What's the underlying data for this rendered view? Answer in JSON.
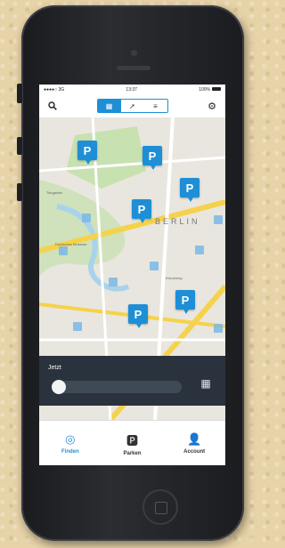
{
  "status_bar": {
    "carrier": "●●●●○ 3G",
    "time": "13:37",
    "battery": "100%"
  },
  "toolbar": {
    "search_icon": "search-icon",
    "segments": [
      {
        "icon": "map-icon",
        "glyph": "▦"
      },
      {
        "icon": "locate-icon",
        "glyph": "➚"
      },
      {
        "icon": "list-icon",
        "glyph": "≡"
      }
    ],
    "settings_icon": "gear-icon"
  },
  "map": {
    "city_label": "BERLIN",
    "street_labels": [
      "Tiergarten",
      "Deutsches Museum",
      "Kreuzberg"
    ],
    "accent": "#1e8fd6"
  },
  "panel": {
    "label": "Jetzt"
  },
  "tabs": [
    {
      "label": "Finden",
      "icon": "target-icon",
      "glyph": "◎",
      "active": true
    },
    {
      "label": "Parken",
      "icon": "parking-icon",
      "glyph": "🅿",
      "active": false
    },
    {
      "label": "Account",
      "icon": "person-icon",
      "glyph": "👤",
      "active": false
    }
  ]
}
